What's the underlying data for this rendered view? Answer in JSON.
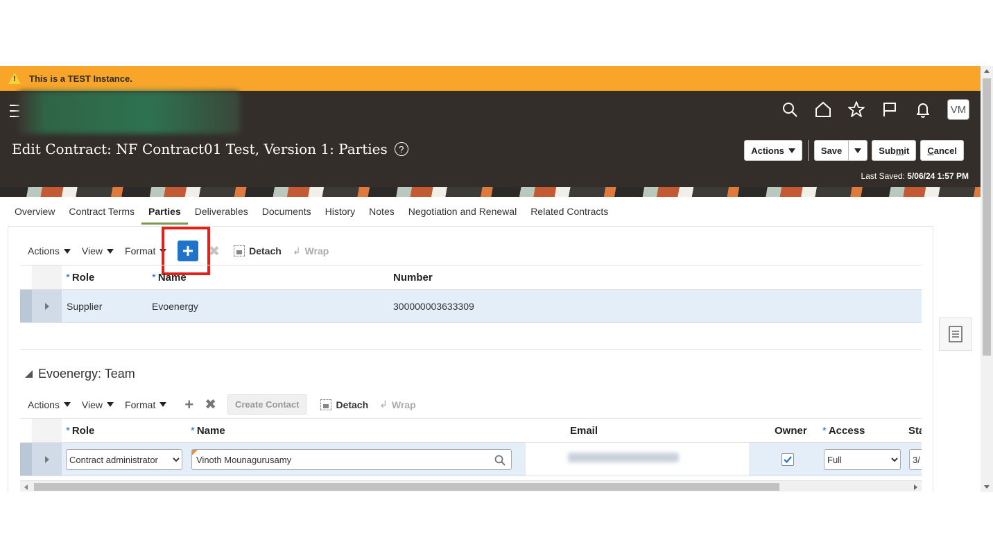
{
  "warning": {
    "text": "This is a TEST Instance."
  },
  "header": {
    "page_title": "Edit Contract: NF Contract01 Test, Version 1: Parties",
    "help": "?",
    "avatar": "VM",
    "actions_label": "Actions",
    "save_label": "Save",
    "submit_label_pre": "Sub",
    "submit_label_u": "m",
    "submit_label_post": "it",
    "cancel_label_u": "C",
    "cancel_label_post": "ancel",
    "last_saved_label": "Last Saved:",
    "last_saved_value": "5/06/24 1:57 PM"
  },
  "tabs": [
    "Overview",
    "Contract Terms",
    "Parties",
    "Deliverables",
    "Documents",
    "History",
    "Notes",
    "Negotiation and Renewal",
    "Related Contracts"
  ],
  "parties_toolbar": {
    "actions": "Actions",
    "view": "View",
    "format": "Format",
    "detach": "Detach",
    "wrap": "Wrap"
  },
  "parties_table": {
    "columns": [
      "Role",
      "Name",
      "Number"
    ],
    "rows": [
      {
        "role": "Supplier",
        "name": "Evoenergy",
        "number": "300000003633309"
      }
    ]
  },
  "team_section": {
    "title": "Evoenergy: Team"
  },
  "team_toolbar": {
    "actions": "Actions",
    "view": "View",
    "format": "Format",
    "create_contact": "Create Contact",
    "detach": "Detach",
    "wrap": "Wrap"
  },
  "team_table": {
    "columns": [
      "Role",
      "Name",
      "Email",
      "Owner",
      "Access",
      "Sta"
    ],
    "rows": [
      {
        "role": "Contract administrator",
        "name": "Vinoth Mounagurusamy",
        "owner": true,
        "access": "Full",
        "start": "3/"
      }
    ]
  },
  "colors": {
    "warning_bar": "#f8a52a",
    "header_bg": "#332e29",
    "add_button": "#1f73c8",
    "highlight_box": "#e3211b",
    "row_selected": "#e4eef9"
  }
}
